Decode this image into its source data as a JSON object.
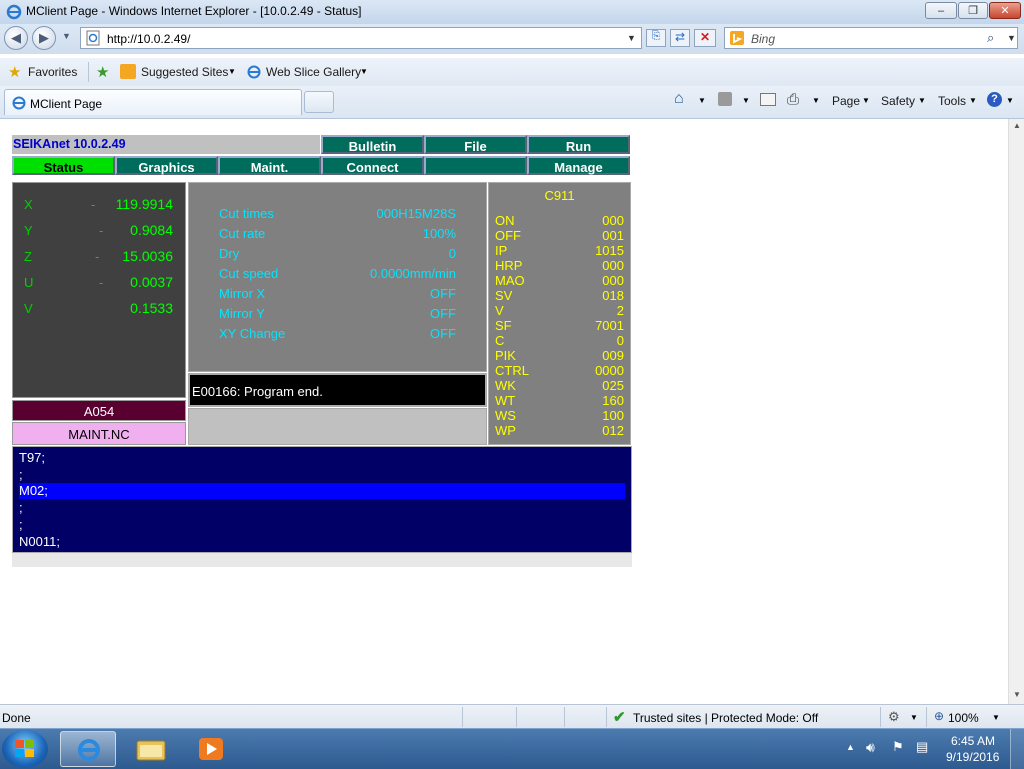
{
  "window": {
    "title": "MClient Page - Windows Internet Explorer - [10.0.2.49 - Status]",
    "minimize": "–",
    "maximize": "❐",
    "close": "✕"
  },
  "address_bar": {
    "url": "http://10.0.2.49/",
    "search_placeholder": "Bing"
  },
  "favorites_bar": {
    "favorites": "Favorites",
    "suggested_sites": "Suggested Sites",
    "web_slice_gallery": "Web Slice Gallery"
  },
  "tabs": {
    "active_tab": "MClient Page"
  },
  "command_bar": {
    "page": "Page",
    "safety": "Safety",
    "tools": "Tools"
  },
  "app": {
    "machine_title": "SEIKAnet 10.0.2.49",
    "menu_row1": [
      "Bulletin",
      "File",
      "Run"
    ],
    "menu_row2": [
      "Status",
      "Graphics",
      "Maint.",
      "Connect",
      "",
      "Manage"
    ],
    "axes": [
      {
        "name": "X",
        "sign": "-",
        "value": "119.9914"
      },
      {
        "name": "Y",
        "sign": "-",
        "value": "0.9084"
      },
      {
        "name": "Z",
        "sign": "-",
        "value": "15.0036"
      },
      {
        "name": "U",
        "sign": "-",
        "value": "0.0037"
      },
      {
        "name": "V",
        "sign": "",
        "value": "0.1533"
      }
    ],
    "cut_status": [
      {
        "label": "Cut times",
        "value": "000H15M28S"
      },
      {
        "label": "Cut rate",
        "value": "100%"
      },
      {
        "label": "Dry",
        "value": "0"
      },
      {
        "label": "Cut speed",
        "value": "0.0000mm/min"
      },
      {
        "label": "Mirror X",
        "value": "OFF"
      },
      {
        "label": "Mirror Y",
        "value": "OFF"
      },
      {
        "label": "XY Change",
        "value": "OFF"
      }
    ],
    "message": "E00166:  Program end.",
    "condition_title": "C911",
    "conditions": [
      {
        "label": "ON",
        "value": "000"
      },
      {
        "label": "OFF",
        "value": "001"
      },
      {
        "label": "IP",
        "value": "1015"
      },
      {
        "label": "HRP",
        "value": "000"
      },
      {
        "label": "MAO",
        "value": "000"
      },
      {
        "label": "SV",
        "value": "018"
      },
      {
        "label": "V",
        "value": "2"
      },
      {
        "label": "SF",
        "value": "7001"
      },
      {
        "label": "C",
        "value": "0"
      },
      {
        "label": "PIK",
        "value": "009"
      },
      {
        "label": "CTRL",
        "value": "0000"
      },
      {
        "label": "WK",
        "value": "025"
      },
      {
        "label": "WT",
        "value": "160"
      },
      {
        "label": "WS",
        "value": "100"
      },
      {
        "label": "WP",
        "value": "012"
      }
    ],
    "program_name": "A054",
    "file_name": "MAINT.NC",
    "code_lines": [
      "T97;",
      ";",
      "M02;",
      ";",
      ";",
      "N0011;"
    ],
    "highlighted_line": 2
  },
  "status_bar": {
    "status": "Done",
    "zone": "Trusted sites | Protected Mode: Off",
    "zoom": "100%"
  },
  "taskbar": {
    "time": "6:45 AM",
    "date": "9/19/2016"
  },
  "colors": {
    "menu_button": "#006c5c",
    "menu_active": "#00e000",
    "axis_text": "#00ff00",
    "cut_text": "#00e5ff",
    "condition_text": "#ffff00",
    "code_background": "#000066",
    "code_highlight": "#0000ff"
  }
}
